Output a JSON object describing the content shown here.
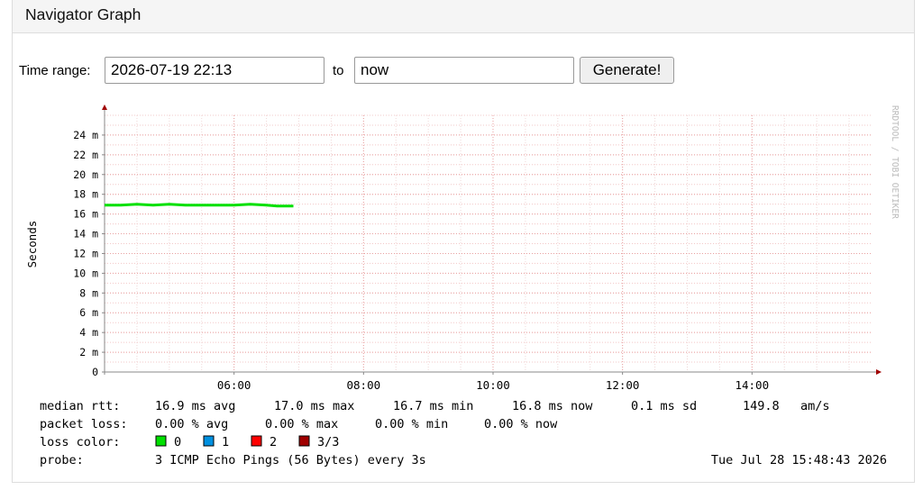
{
  "panel": {
    "title": "Navigator Graph"
  },
  "form": {
    "time_range_label": "Time range:",
    "start_value": "2026-07-19 22:13",
    "to_label": "to",
    "end_value": "now",
    "generate_label": "Generate!"
  },
  "chart_data": {
    "type": "line",
    "ylabel": "Seconds",
    "watermark": "RRDTOOL / TOBI OETIKER",
    "y_unit_suffix": "m",
    "ylim": [
      0,
      0.026
    ],
    "y_ticks": [
      {
        "value": 0,
        "label": "0"
      },
      {
        "value": 0.002,
        "label": "2 m"
      },
      {
        "value": 0.004,
        "label": "4 m"
      },
      {
        "value": 0.006,
        "label": "6 m"
      },
      {
        "value": 0.008,
        "label": "8 m"
      },
      {
        "value": 0.01,
        "label": "10 m"
      },
      {
        "value": 0.012,
        "label": "12 m"
      },
      {
        "value": 0.014,
        "label": "14 m"
      },
      {
        "value": 0.016,
        "label": "16 m"
      },
      {
        "value": 0.018,
        "label": "18 m"
      },
      {
        "value": 0.02,
        "label": "20 m"
      },
      {
        "value": 0.022,
        "label": "22 m"
      },
      {
        "value": 0.024,
        "label": "24 m"
      }
    ],
    "xlim": [
      "04:00",
      "15:50"
    ],
    "x_ticks": [
      "06:00",
      "08:00",
      "10:00",
      "12:00",
      "14:00"
    ],
    "series": [
      {
        "color": "#00e000",
        "x": [
          "04:00",
          "04:15",
          "04:30",
          "04:45",
          "05:00",
          "05:15",
          "05:30",
          "05:45",
          "06:00",
          "06:15",
          "06:30",
          "06:40",
          "06:45",
          "06:55"
        ],
        "y": [
          0.0169,
          0.0169,
          0.017,
          0.0169,
          0.017,
          0.0169,
          0.0169,
          0.0169,
          0.0169,
          0.017,
          0.0169,
          0.0168,
          0.0168,
          0.0168
        ]
      }
    ],
    "grid": true,
    "legend": {
      "median_rtt": {
        "label": "median rtt:",
        "avg": "16.9 ms avg",
        "max": "17.0 ms max",
        "min": "16.7 ms min",
        "now": "16.8 ms now",
        "sd": "0.1 ms sd",
        "ams": "149.8",
        "ams_unit": "am/s"
      },
      "packet_loss": {
        "label": "packet loss:",
        "avg": "0.00 % avg",
        "max": "0.00 % max",
        "min": "0.00 % min",
        "now": "0.00 % now"
      },
      "loss_color": {
        "label": "loss color:",
        "items": [
          {
            "label": "0",
            "color": "#00e000"
          },
          {
            "label": "1",
            "color": "#0090e0"
          },
          {
            "label": "2",
            "color": "#ff0000"
          },
          {
            "label": "3/3",
            "color": "#a00000"
          }
        ]
      },
      "probe": {
        "label": "probe:",
        "text": "3 ICMP Echo Pings (56 Bytes) every 3s"
      },
      "timestamp": "Tue Jul 28 15:48:43 2026"
    }
  }
}
